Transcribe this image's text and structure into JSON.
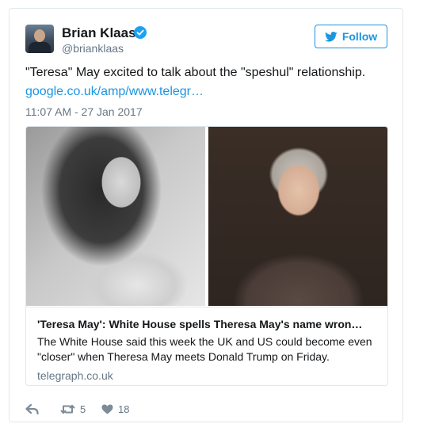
{
  "user": {
    "name": "Brian Klaas",
    "handle": "@brianklaas"
  },
  "follow_label": "Follow",
  "tweet": {
    "text": "\"Teresa\" May excited to talk about the \"speshul\" relationship.",
    "link": "google.co.uk/amp/www.telegr…",
    "timestamp": "11:07 AM - 27 Jan 2017"
  },
  "card": {
    "title": "'Teresa May': White House spells Theresa May's name wron…",
    "description": "The White House said this week the UK and US could become even \"closer\" when Theresa May meets Donald Trump on Friday.",
    "domain": "telegraph.co.uk"
  },
  "actions": {
    "retweet_count": "5",
    "like_count": "18"
  },
  "colors": {
    "accent": "#1b95e0",
    "secondary_text": "#657786",
    "border": "#e1e8ed"
  },
  "icons": [
    "verified-badge-icon",
    "twitter-bird-icon",
    "reply-icon",
    "retweet-icon",
    "heart-icon"
  ]
}
